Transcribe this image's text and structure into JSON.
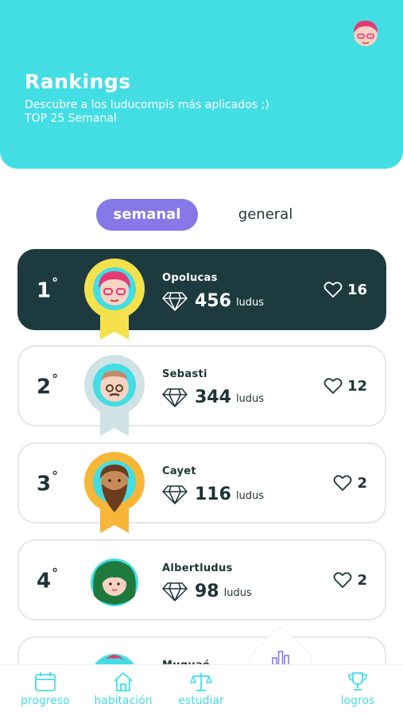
{
  "header": {
    "title": "Rankings",
    "subtitle": "Descubre a los luducompis más aplicados ;)",
    "period": "TOP 25 Semanal",
    "avatar_icon": "user-avatar-icon"
  },
  "tabs": {
    "weekly": "semanal",
    "general": "general"
  },
  "ranking": [
    {
      "rank": "1",
      "ordinal": "°",
      "name": "Opolucas",
      "points": "456",
      "unit": "ludus",
      "likes": "16",
      "medal": "gold"
    },
    {
      "rank": "2",
      "ordinal": "°",
      "name": "Sebasti",
      "points": "344",
      "unit": "ludus",
      "likes": "12",
      "medal": "silver"
    },
    {
      "rank": "3",
      "ordinal": "°",
      "name": "Cayet",
      "points": "116",
      "unit": "ludus",
      "likes": "2",
      "medal": "bronze"
    },
    {
      "rank": "4",
      "ordinal": "°",
      "name": "Albertludus",
      "points": "98",
      "unit": "ludus",
      "likes": "2",
      "medal": "none"
    },
    {
      "name": "Muquaé"
    }
  ],
  "nav": {
    "progress": "progreso",
    "room": "habitación",
    "study": "estudiar",
    "achievements": "logros",
    "rankings_icon": "bar-chart-icon"
  },
  "colors": {
    "primary": "#43dde4",
    "accent": "#8678e7",
    "dark": "#1d3a3f",
    "gold": "#f5e14b",
    "silver": "#cfe2e6",
    "bronze": "#f7b638"
  }
}
